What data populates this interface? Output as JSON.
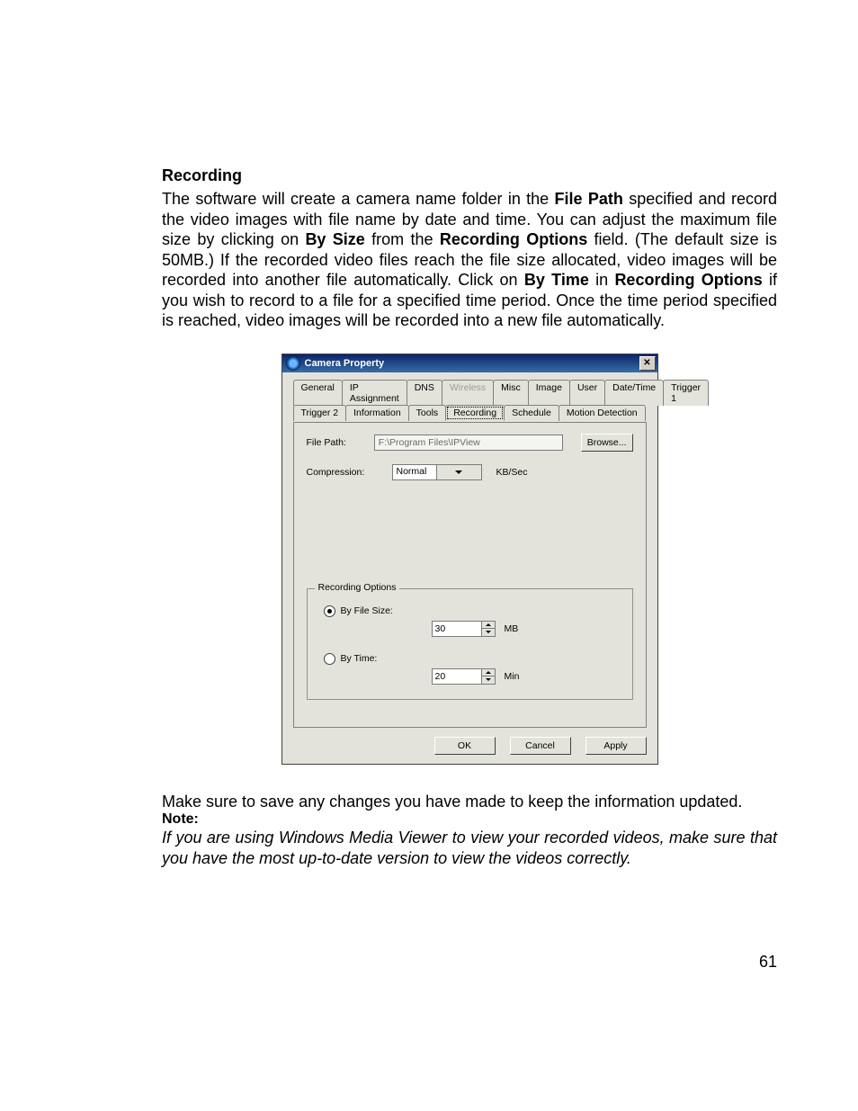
{
  "heading": "Recording",
  "para1_parts": {
    "t1": "The software will create a camera name folder in the ",
    "b1": "File Path",
    "t2": " specified and record the video images with file name by date and time.  You can adjust the maximum file size by clicking on ",
    "b2": "By Size",
    "t3": " from the ",
    "b3": "Recording Options",
    "t4": " field. (The default size is 50MB.) If the recorded video files reach the file size allocated, video images will be recorded into another file automatically. Click on ",
    "b4": "By Time",
    "t5": " in ",
    "b5": "Recording Options",
    "t6": " if you wish to record to a file for a specified time period. Once the time period specified is reached, video images will be recorded into a new file automatically."
  },
  "para2": "Make sure to save any changes you have made to keep the information updated.",
  "note_label": "Note:",
  "note_text": "If you are using Windows Media Viewer to view your recorded videos, make sure that you have the most up-to-date version to view the videos correctly.",
  "page_number": "61",
  "dialog": {
    "title": "Camera Property",
    "tabs_row1": [
      "General",
      "IP Assignment",
      "DNS",
      "Wireless",
      "Misc",
      "Image",
      "User",
      "Date/Time",
      "Trigger 1"
    ],
    "tabs_row2": [
      "Trigger 2",
      "Information",
      "Tools",
      "Recording",
      "Schedule",
      "Motion Detection"
    ],
    "active_tab": "Recording",
    "disabled_tab": "Wireless",
    "file_path_label": "File Path:",
    "file_path_value": "F:\\Program Files\\IPView",
    "browse_label": "Browse...",
    "compression_label": "Compression:",
    "compression_value": "Normal",
    "compression_unit": "KB/Sec",
    "group_title": "Recording Options",
    "opt_by_size": "By File Size:",
    "opt_by_time": "By Time:",
    "size_value": "30",
    "size_unit": "MB",
    "time_value": "20",
    "time_unit": "Min",
    "selected_option": "size",
    "ok_label": "OK",
    "cancel_label": "Cancel",
    "apply_label": "Apply"
  }
}
